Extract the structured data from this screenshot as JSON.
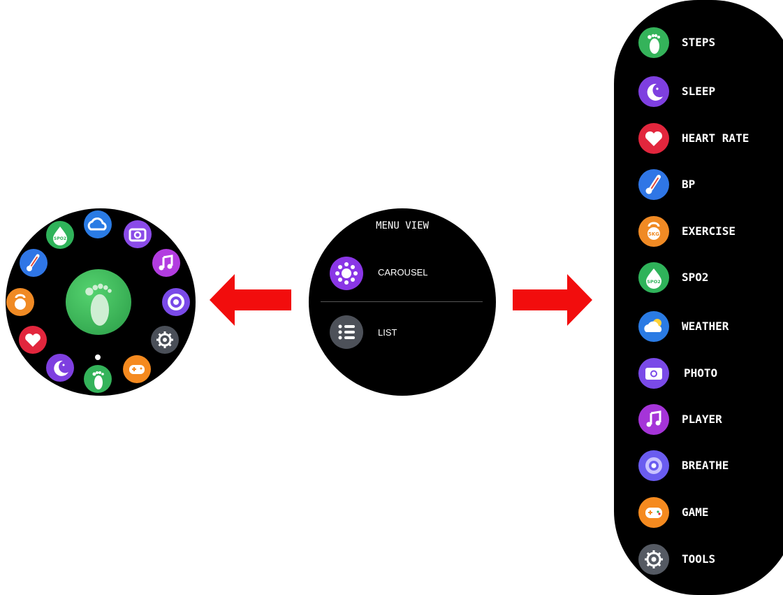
{
  "menu_view": {
    "title": "MENU VIEW",
    "options": [
      {
        "label": "CAROUSEL",
        "icon": "carousel-icon"
      },
      {
        "label": "LIST",
        "icon": "list-icon"
      }
    ]
  },
  "carousel": {
    "center_app": "steps",
    "ring_apps": [
      "weather-icon",
      "photo-icon",
      "player-icon",
      "breathe-icon",
      "tools-icon",
      "game-icon",
      "steps-icon",
      "sleep-icon",
      "heart-rate-icon",
      "exercise-icon",
      "bp-icon",
      "spo2-icon"
    ],
    "spo2_badge": "SPO2"
  },
  "list": {
    "items": [
      {
        "label": "STEPS",
        "icon": "steps-icon",
        "color": "#34b35a"
      },
      {
        "label": "SLEEP",
        "icon": "sleep-icon",
        "color": "#7e3fe0"
      },
      {
        "label": "HEART RATE",
        "icon": "heart-icon",
        "color": "#e2263d"
      },
      {
        "label": "BP",
        "icon": "thermometer-icon",
        "color": "#2f76e6"
      },
      {
        "label": "EXERCISE",
        "icon": "kettlebell-icon",
        "color": "#f08a24"
      },
      {
        "label": "SPO2",
        "icon": "spo2-drop-icon",
        "color": "#2fb35a"
      },
      {
        "label": "WEATHER",
        "icon": "cloud-icon",
        "color": "#2a7be4"
      },
      {
        "label": "PHOTO",
        "icon": "camera-icon",
        "color": "#7a4ae8"
      },
      {
        "label": "PLAYER",
        "icon": "music-note-icon",
        "color": "#a534d8"
      },
      {
        "label": "BREATHE",
        "icon": "breathe-icon",
        "color": "#6a5cf0"
      },
      {
        "label": "GAME",
        "icon": "gamepad-icon",
        "color": "#f58a1f"
      },
      {
        "label": "TOOLS",
        "icon": "gear-icon",
        "color": "#555a63"
      }
    ],
    "kg_badge": "5KG",
    "spo2_badge": "SPO2"
  },
  "arrow_color": "#f20d0d"
}
